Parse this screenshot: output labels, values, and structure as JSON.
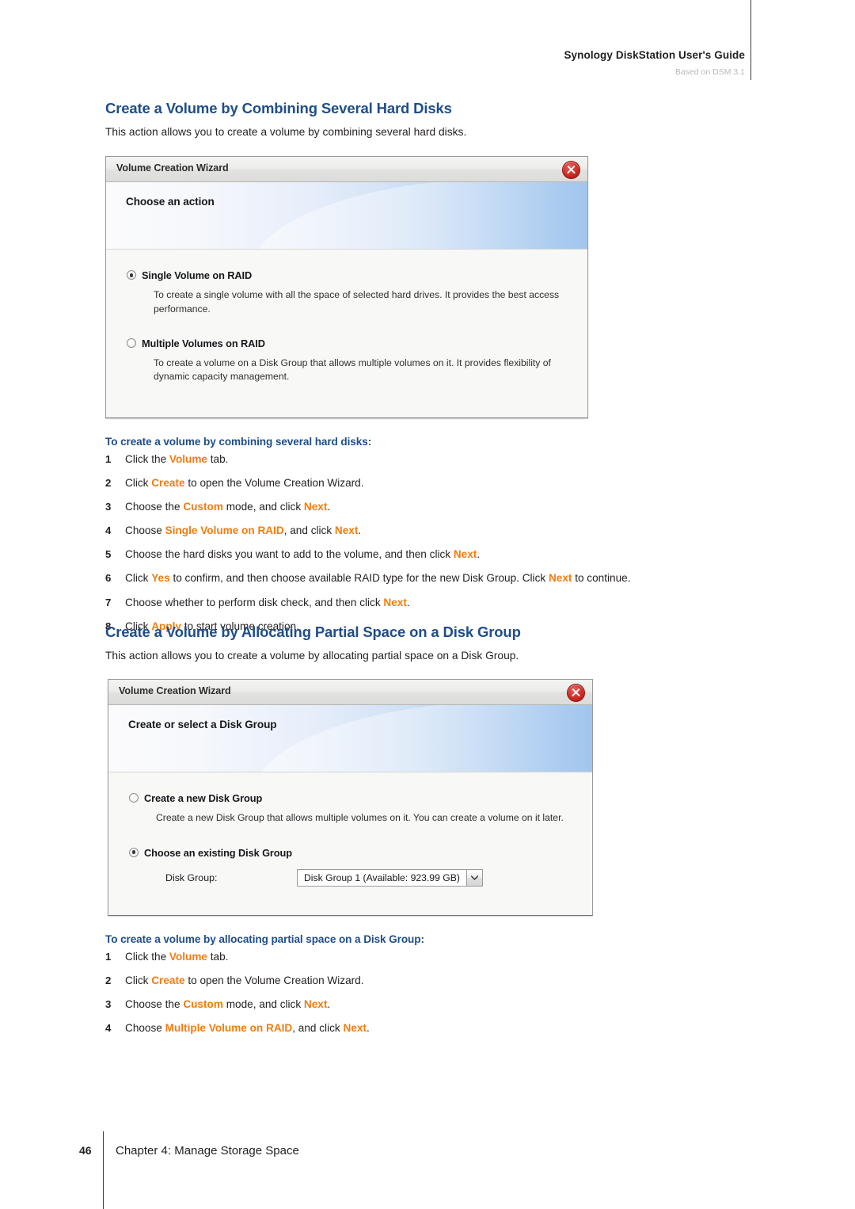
{
  "header": {
    "title": "Synology DiskStation User's Guide",
    "subtitle": "Based on DSM 3.1"
  },
  "sections": [
    {
      "title": "Create a Volume by Combining Several Hard Disks",
      "intro": "This action allows you to create a volume by combining several hard disks.",
      "dialog": {
        "window_title": "Volume Creation Wizard",
        "close_icon": "close-icon",
        "banner_title": "Choose an action",
        "options": [
          {
            "label": "Single Volume on RAID",
            "selected": true,
            "description": "To create a single volume with all the space of selected hard drives. It provides the best access performance."
          },
          {
            "label": "Multiple Volumes on RAID",
            "selected": false,
            "description": "To create a volume on a Disk Group that allows multiple volumes on it. It provides flexibility of dynamic capacity management."
          }
        ]
      },
      "procedure": {
        "title": "To create a volume by combining several hard disks:",
        "steps": [
          {
            "num": "1",
            "parts": [
              {
                "t": "Click the ",
                "hl": false
              },
              {
                "t": "Volume",
                "hl": true
              },
              {
                "t": " tab.",
                "hl": false
              }
            ]
          },
          {
            "num": "2",
            "parts": [
              {
                "t": "Click ",
                "hl": false
              },
              {
                "t": "Create",
                "hl": true
              },
              {
                "t": " to open the Volume Creation Wizard.",
                "hl": false
              }
            ]
          },
          {
            "num": "3",
            "parts": [
              {
                "t": "Choose the ",
                "hl": false
              },
              {
                "t": "Custom",
                "hl": true
              },
              {
                "t": " mode, and click ",
                "hl": false
              },
              {
                "t": "Next",
                "hl": true
              },
              {
                "t": ".",
                "hl": false
              }
            ]
          },
          {
            "num": "4",
            "parts": [
              {
                "t": "Choose ",
                "hl": false
              },
              {
                "t": "Single Volume on RAID",
                "hl": true
              },
              {
                "t": ", and click ",
                "hl": false
              },
              {
                "t": "Next",
                "hl": true
              },
              {
                "t": ".",
                "hl": false
              }
            ]
          },
          {
            "num": "5",
            "parts": [
              {
                "t": "Choose the hard disks you want to add to the volume, and then click ",
                "hl": false
              },
              {
                "t": "Next",
                "hl": true
              },
              {
                "t": ".",
                "hl": false
              }
            ]
          },
          {
            "num": "6",
            "parts": [
              {
                "t": "Click ",
                "hl": false
              },
              {
                "t": "Yes",
                "hl": true
              },
              {
                "t": " to confirm, and then choose available RAID type for the new Disk Group. Click ",
                "hl": false
              },
              {
                "t": "Next",
                "hl": true
              },
              {
                "t": " to continue.",
                "hl": false
              }
            ]
          },
          {
            "num": "7",
            "parts": [
              {
                "t": "Choose whether to perform disk check, and then click ",
                "hl": false
              },
              {
                "t": "Next",
                "hl": true
              },
              {
                "t": ".",
                "hl": false
              }
            ]
          },
          {
            "num": "8",
            "parts": [
              {
                "t": "Click ",
                "hl": false
              },
              {
                "t": "Apply",
                "hl": true
              },
              {
                "t": " to start volume creation.",
                "hl": false
              }
            ]
          }
        ]
      }
    },
    {
      "title": "Create a Volume by Allocating Partial Space on a Disk Group",
      "intro": "This action allows you to create a volume by allocating partial space on a Disk Group.",
      "dialog": {
        "window_title": "Volume Creation Wizard",
        "close_icon": "close-icon",
        "banner_title": "Create or select a Disk Group",
        "options": [
          {
            "label": "Create a new Disk Group",
            "selected": false,
            "description": "Create a new Disk Group that allows multiple volumes on it. You can create a volume on it later."
          },
          {
            "label": "Choose an existing Disk Group",
            "selected": true,
            "description": ""
          }
        ],
        "field": {
          "label": "Disk Group:",
          "value": "Disk Group 1 (Available: 923.99 GB)",
          "dropdown_icon": "chevron-down-icon"
        }
      },
      "procedure": {
        "title": "To create a volume by allocating partial space on a Disk Group:",
        "steps": [
          {
            "num": "1",
            "parts": [
              {
                "t": "Click the ",
                "hl": false
              },
              {
                "t": "Volume",
                "hl": true
              },
              {
                "t": " tab.",
                "hl": false
              }
            ]
          },
          {
            "num": "2",
            "parts": [
              {
                "t": "Click ",
                "hl": false
              },
              {
                "t": "Create",
                "hl": true
              },
              {
                "t": " to open the Volume Creation Wizard.",
                "hl": false
              }
            ]
          },
          {
            "num": "3",
            "parts": [
              {
                "t": "Choose the ",
                "hl": false
              },
              {
                "t": "Custom",
                "hl": true
              },
              {
                "t": " mode, and click ",
                "hl": false
              },
              {
                "t": "Next",
                "hl": true
              },
              {
                "t": ".",
                "hl": false
              }
            ]
          },
          {
            "num": "4",
            "parts": [
              {
                "t": "Choose ",
                "hl": false
              },
              {
                "t": "Multiple Volume on RAID",
                "hl": true
              },
              {
                "t": ", and click ",
                "hl": false
              },
              {
                "t": "Next",
                "hl": true
              },
              {
                "t": ".",
                "hl": false
              }
            ]
          }
        ]
      }
    }
  ],
  "footer": {
    "page_number": "46",
    "chapter": "Chapter 4: Manage Storage Space"
  },
  "colors": {
    "heading_blue": "#1f4e87",
    "highlight_orange": "#ef7d11",
    "close_red": "#cf2b25"
  }
}
